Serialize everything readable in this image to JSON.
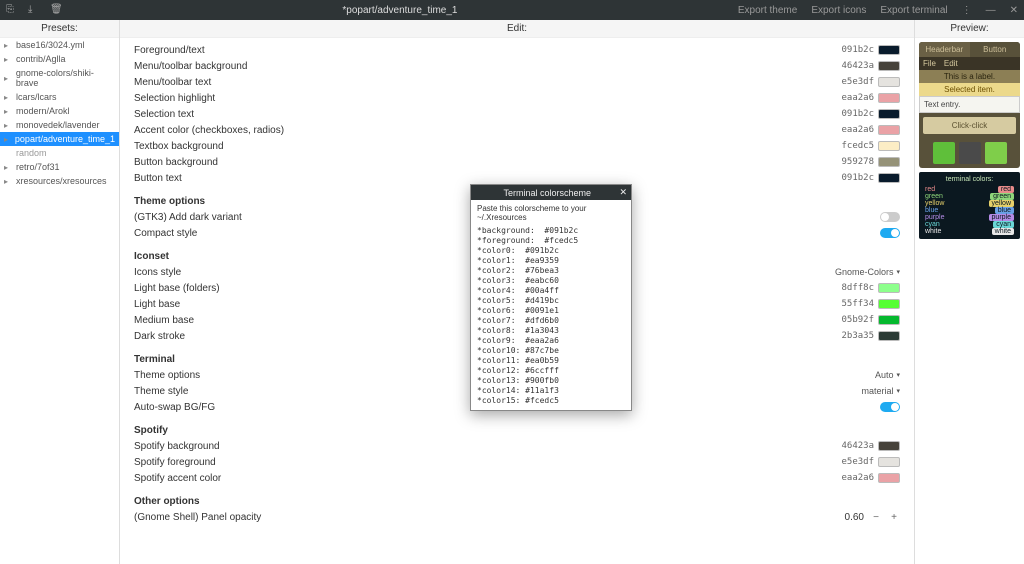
{
  "titlebar": {
    "title": "*popart/adventure_time_1",
    "actions": [
      "Export theme",
      "Export icons",
      "Export terminal"
    ],
    "win": {
      "menu": "⋮",
      "min": "—",
      "close": "✕"
    }
  },
  "columns": {
    "presets": "Presets:",
    "edit": "Edit:",
    "preview": "Preview:"
  },
  "presets": [
    {
      "label": "base16/3024.yml"
    },
    {
      "label": "contrib/Aglla"
    },
    {
      "label": "gnome-colors/shiki-brave"
    },
    {
      "label": "lcars/lcars"
    },
    {
      "label": "modern/Arokl"
    },
    {
      "label": "monovedek/lavender"
    },
    {
      "label": "popart/adventure_time_1",
      "selected": true
    },
    {
      "label": "random",
      "dim": true,
      "nochev": true
    },
    {
      "label": "retro/7of31"
    },
    {
      "label": "xresources/xresources"
    }
  ],
  "sections": [
    {
      "head": null,
      "rows": [
        {
          "label": "Foreground/text",
          "hex": "091b2c",
          "color": "#091b2c"
        },
        {
          "label": "Menu/toolbar background",
          "hex": "46423a",
          "color": "#46423a"
        },
        {
          "label": "Menu/toolbar text",
          "hex": "e5e3df",
          "color": "#e5e3df"
        },
        {
          "label": "Selection highlight",
          "hex": "eaa2a6",
          "color": "#eaa2a6"
        },
        {
          "label": "Selection text",
          "hex": "091b2c",
          "color": "#091b2c"
        },
        {
          "label": "Accent color (checkboxes, radios)",
          "hex": "eaa2a6",
          "color": "#eaa2a6"
        },
        {
          "label": "Textbox background",
          "hex": "fcedc5",
          "color": "#fcedc5"
        },
        {
          "label": "Button background",
          "hex": "959278",
          "color": "#959278"
        },
        {
          "label": "Button text",
          "hex": "091b2c",
          "color": "#091b2c"
        }
      ]
    },
    {
      "head": "Theme options",
      "rows": [
        {
          "label": "(GTK3) Add dark variant",
          "toggle": false
        },
        {
          "label": "Compact style",
          "toggle": true
        }
      ]
    },
    {
      "head": "Iconset",
      "rows": [
        {
          "label": "Icons style",
          "dropdown": "Gnome-Colors"
        },
        {
          "label": "Light base (folders)",
          "hex": "8dff8c",
          "color": "#8dff8c"
        },
        {
          "label": "Light base",
          "hex": "55ff34",
          "color": "#55ff34"
        },
        {
          "label": "Medium base",
          "hex": "05b92f",
          "color": "#05b92f"
        },
        {
          "label": "Dark stroke",
          "hex": "2b3a35",
          "color": "#2b3a35"
        }
      ]
    },
    {
      "head": "Terminal",
      "rows": [
        {
          "label": "Theme options",
          "dropdown": "Auto"
        },
        {
          "label": "Theme style",
          "dropdown": "material"
        },
        {
          "label": "Auto-swap BG/FG",
          "toggle": true
        }
      ]
    },
    {
      "head": "Spotify",
      "rows": [
        {
          "label": "Spotify background",
          "hex": "46423a",
          "color": "#46423a"
        },
        {
          "label": "Spotify foreground",
          "hex": "e5e3df",
          "color": "#e5e3df"
        },
        {
          "label": "Spotify accent color",
          "hex": "eaa2a6",
          "color": "#eaa2a6"
        }
      ]
    },
    {
      "head": "Other options",
      "rows": [
        {
          "label": "(Gnome Shell) Panel opacity",
          "stepper": "0.60"
        }
      ]
    }
  ],
  "preview": {
    "tabs": [
      "Headerbar",
      "Button"
    ],
    "menu": [
      "File",
      "Edit"
    ],
    "label": "This is a label.",
    "selected": "Selected item.",
    "entry": "Text entry.",
    "button": "Click-click",
    "icons": [
      {
        "color": "#5fbf3a"
      },
      {
        "color": "#4a4a4a"
      },
      {
        "color": "#7fce4a"
      }
    ],
    "term_title": "terminal colors:",
    "term": [
      {
        "name": "red",
        "color": "#e88b8b"
      },
      {
        "name": "green",
        "color": "#8fd67a"
      },
      {
        "name": "yellow",
        "color": "#e6d06a"
      },
      {
        "name": "blue",
        "color": "#6aa0e6"
      },
      {
        "name": "purple",
        "color": "#b48be6"
      },
      {
        "name": "cyan",
        "color": "#6ad6d6"
      },
      {
        "name": "white",
        "color": "#e8e8e8"
      }
    ]
  },
  "modal": {
    "title": "Terminal colorscheme",
    "close": "✕",
    "desc": "Paste this colorscheme to your ~/.Xresources",
    "content": "*background:  #091b2c\n*foreground:  #fcedc5\n*color0:  #091b2c\n*color1:  #ea9359\n*color2:  #76bea3\n*color3:  #eabc60\n*color4:  #00a4ff\n*color5:  #d419bc\n*color6:  #0091e1\n*color7:  #dfd6b0\n*color8:  #1a3043\n*color9:  #eaa2a6\n*color10: #87c7be\n*color11: #ea0b59\n*color12: #6ccfff\n*color13: #900fb0\n*color14: #11a1f3\n*color15: #fcedc5"
  }
}
